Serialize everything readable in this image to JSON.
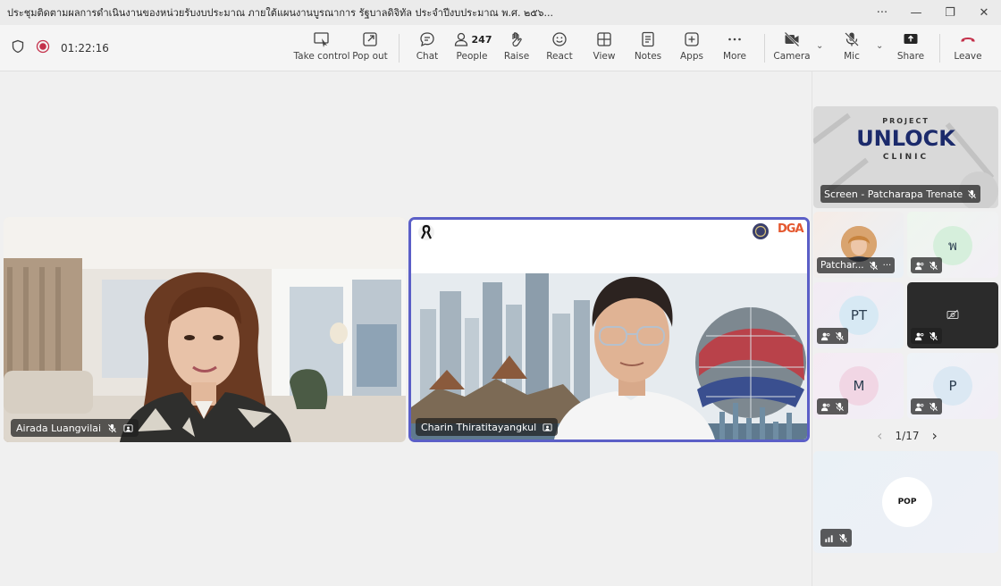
{
  "window": {
    "title": "ประชุมติดตามผลการดำเนินงานของหน่วยรับงบประมาณ ภายใต้แผนงานบูรณาการ รัฐบาลดิจิทัล ประจำปีงบประมาณ พ.ศ. ๒๕๖...",
    "controls": [
      "···",
      "—",
      "❐",
      "✕"
    ]
  },
  "meeting": {
    "elapsed": "01:22:16"
  },
  "toolbar": {
    "take_control": "Take control",
    "pop_out": "Pop out",
    "chat": "Chat",
    "people": "People",
    "people_count": "247",
    "raise": "Raise",
    "react": "React",
    "view": "View",
    "notes": "Notes",
    "apps": "Apps",
    "more": "More",
    "camera": "Camera",
    "mic": "Mic",
    "share": "Share",
    "leave": "Leave"
  },
  "stage": {
    "tiles": [
      {
        "name": "Airada Luangvilai",
        "mic_muted": true
      },
      {
        "name": "Charin Thiratitayangkul",
        "mic_muted": false,
        "active_speaker": true,
        "logo_text": "DGA"
      }
    ]
  },
  "sidebar": {
    "screen_share": {
      "label": "Screen - Patcharapa Trenate",
      "slide_line1": "PROJECT",
      "slide_line2": "UNLOCK",
      "slide_line3": "CLINIC"
    },
    "participants": [
      {
        "name": "Patchar...",
        "initials": "",
        "type": "photo"
      },
      {
        "name": "",
        "initials": "พ",
        "type": "avatar"
      },
      {
        "name": "",
        "initials": "PT",
        "type": "avatar"
      },
      {
        "name": "",
        "initials": "",
        "type": "camera-off"
      },
      {
        "name": "",
        "initials": "M",
        "type": "avatar"
      },
      {
        "name": "",
        "initials": "P",
        "type": "avatar"
      }
    ],
    "pager": {
      "text": "1/17",
      "prev": "‹",
      "next": "›"
    },
    "pinned": {
      "initials": "POP"
    }
  },
  "colors": {
    "active_border": "#5b5fc7",
    "leave_red": "#c4314b",
    "record_red": "#c4314b"
  }
}
